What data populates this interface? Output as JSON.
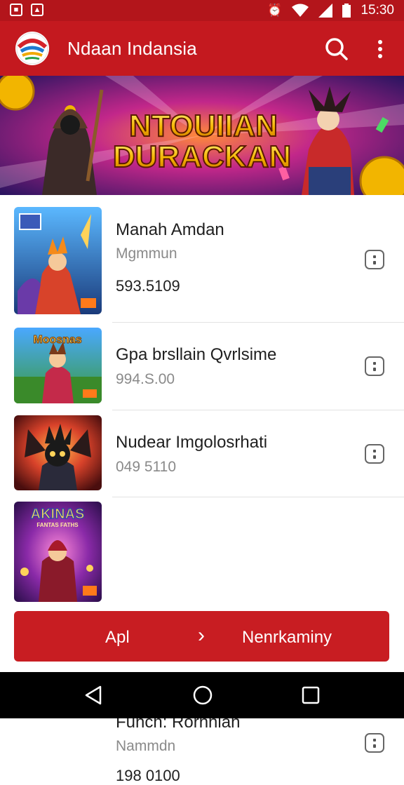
{
  "status_bar": {
    "time": "15:30"
  },
  "app_bar": {
    "title": "Ndaan Indansia"
  },
  "banner": {
    "line1": "NTOUIIAN",
    "line2": "DURACKAN"
  },
  "items": [
    {
      "name": "Manah Amdan",
      "sub": "Mgmmun",
      "num": "593.5109"
    },
    {
      "name": "Gpa brsllain Qvrlsime",
      "sub": "994.S.00"
    },
    {
      "name": "Nudear Imgolosrhati",
      "sub": "049 5110"
    },
    {
      "name": "Funch: Rornnian",
      "sub": "Nammdn",
      "num": "198 0100"
    }
  ],
  "thumb_labels": {
    "item2": "Moosnas",
    "item4_top": "AKINAS",
    "item4_sub": "FANTAS FATHS"
  },
  "cta": {
    "left_label": "Apl",
    "right_label": "Nenrkaminy"
  },
  "colors": {
    "primary": "#c4191f",
    "status": "#b3151b",
    "cta": "#c81d22"
  }
}
